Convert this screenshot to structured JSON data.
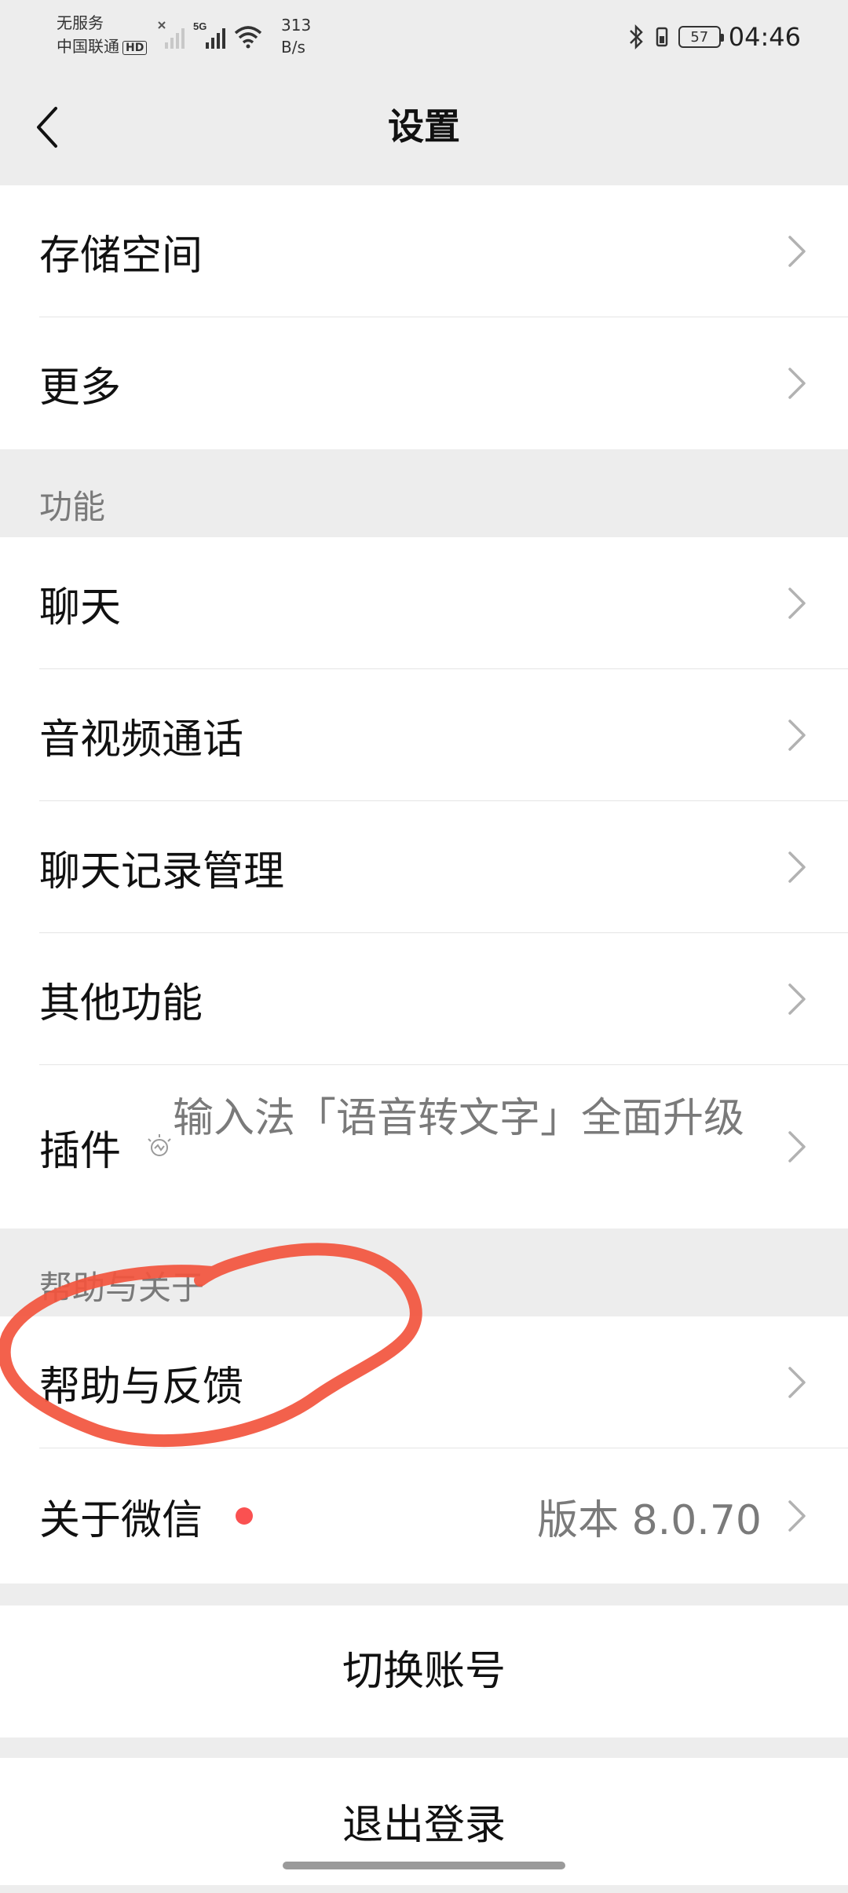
{
  "status_bar": {
    "carrier_line1": "无服务",
    "carrier_line2": "中国联通",
    "hd_badge": "HD",
    "network_type": "5G",
    "net_speed_value": "313",
    "net_speed_unit": "B/s",
    "battery": "57",
    "time": "04:46",
    "icons": [
      "no-signal-icon",
      "signal-icon",
      "wifi-icon",
      "bluetooth-icon",
      "phone-vibrate-icon",
      "battery-icon"
    ]
  },
  "nav": {
    "back_icon": "chevron-left-icon",
    "title": "设置"
  },
  "group_storage": {
    "items": [
      {
        "label": "存储空间"
      },
      {
        "label": "更多"
      }
    ]
  },
  "section_features": {
    "header": "功能",
    "items": [
      {
        "label": "聊天"
      },
      {
        "label": "音视频通话"
      },
      {
        "label": "聊天记录管理"
      },
      {
        "label": "其他功能"
      },
      {
        "label": "插件",
        "hint": "输入法「语音转文字」全面升级"
      }
    ]
  },
  "section_help": {
    "header": "帮助与关于",
    "items": [
      {
        "label": "帮助与反馈"
      },
      {
        "label": "关于微信",
        "value": "版本 8.0.70",
        "badge": "red-dot"
      }
    ]
  },
  "actions": {
    "switch_account": "切换账号",
    "logout": "退出登录"
  },
  "colors": {
    "background": "#ededed",
    "card": "#ffffff",
    "secondary_text": "#7a7a7a",
    "badge_red": "#fa5151",
    "annotation_red": "#f2543d"
  }
}
